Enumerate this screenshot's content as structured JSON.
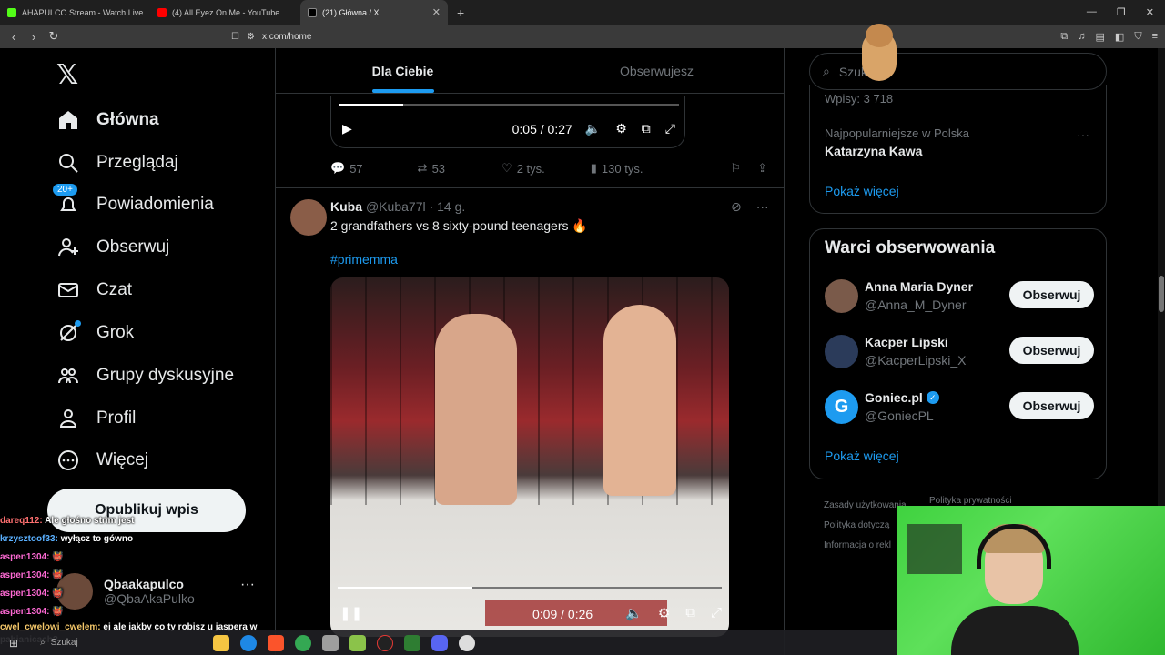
{
  "browser": {
    "tabs": [
      {
        "title": "AHAPULCO Stream - Watch Live on K",
        "color": "#53fc18"
      },
      {
        "title": "(4) All Eyez On Me - YouTube",
        "color": "#ff0000"
      },
      {
        "title": "(21) Główna / X",
        "color": "#ffffff",
        "active": true
      }
    ],
    "url": "x.com/home"
  },
  "nav": {
    "items": [
      {
        "label": "Główna",
        "icon": "home-icon"
      },
      {
        "label": "Przeglądaj",
        "icon": "search-icon"
      },
      {
        "label": "Powiadomienia",
        "icon": "bell-icon",
        "badge": "20+"
      },
      {
        "label": "Obserwuj",
        "icon": "follow-icon"
      },
      {
        "label": "Czat",
        "icon": "mail-icon"
      },
      {
        "label": "Grok",
        "icon": "grok-icon"
      },
      {
        "label": "Grupy dyskusyjne",
        "icon": "communities-icon"
      },
      {
        "label": "Profil",
        "icon": "profile-icon"
      },
      {
        "label": "Więcej",
        "icon": "more-icon"
      }
    ],
    "post_button": "Opublikuj wpis",
    "account": {
      "name": "Qbaakapulco",
      "handle": "@QbaAkaPulko"
    }
  },
  "feed": {
    "tabs": [
      "Dla Ciebie",
      "Obserwujesz"
    ],
    "video1": {
      "time": "0:05 / 0:27",
      "progress": 0.19
    },
    "actions": {
      "replies": "57",
      "reposts": "53",
      "likes": "2 tys.",
      "views": "130 tys."
    },
    "post": {
      "name": "Kuba",
      "handle": "@Kuba77l",
      "time": "· 14 g.",
      "text": "2 grandfathers vs 8 sixty-pound teenagers 🔥",
      "hashtag": "#primemma",
      "video_time": "0:09 / 0:26",
      "video_progress": 0.35
    }
  },
  "right": {
    "search_placeholder": "Szukaj",
    "trend": {
      "entries": "Wpisy: 3 718",
      "context": "Najpopularniejsze w Polska",
      "topic": "Katarzyna Kawa",
      "show_more": "Pokaż więcej"
    },
    "who_to_follow": {
      "title": "Warci obserwowania",
      "users": [
        {
          "name": "Anna Maria Dyner",
          "handle": "@Anna_M_Dyner",
          "button": "Obserwuj",
          "color": "#7a5a4a"
        },
        {
          "name": "Kacper Lipski",
          "handle": "@KacperLipski_X",
          "button": "Obserwuj",
          "color": "#2b3b5a"
        },
        {
          "name": "Goniec.pl",
          "handle": "@GoniecPL",
          "button": "Obserwuj",
          "color": "#1d9bf0",
          "verified": true
        }
      ],
      "show_more": "Pokaż więcej"
    },
    "footer": [
      "Zasady użytkowania",
      "Polityka dotyczą",
      "Informacja o rekl"
    ],
    "footer2": "Polityka prywatności"
  },
  "chat": [
    {
      "user": "dareq112:",
      "msg": "Ale głośno strim jest",
      "cls": "u1"
    },
    {
      "user": "krzysztoof33:",
      "msg": "wyłącz to gówno",
      "cls": "u2"
    },
    {
      "user": "aspen1304:",
      "msg": "👹",
      "cls": "u3"
    },
    {
      "user": "aspen1304:",
      "msg": "👹",
      "cls": "u3"
    },
    {
      "user": "aspen1304:",
      "msg": "👹",
      "cls": "u3"
    },
    {
      "user": "aspen1304:",
      "msg": "👹",
      "cls": "u3"
    },
    {
      "user": "cwel_cwelowi_cwelem:",
      "msg": "ej ale jakby co ty robisz u jaspera w pabianicach?",
      "cls": "u4"
    }
  ],
  "taskbar": {
    "search": "Szukaj"
  }
}
